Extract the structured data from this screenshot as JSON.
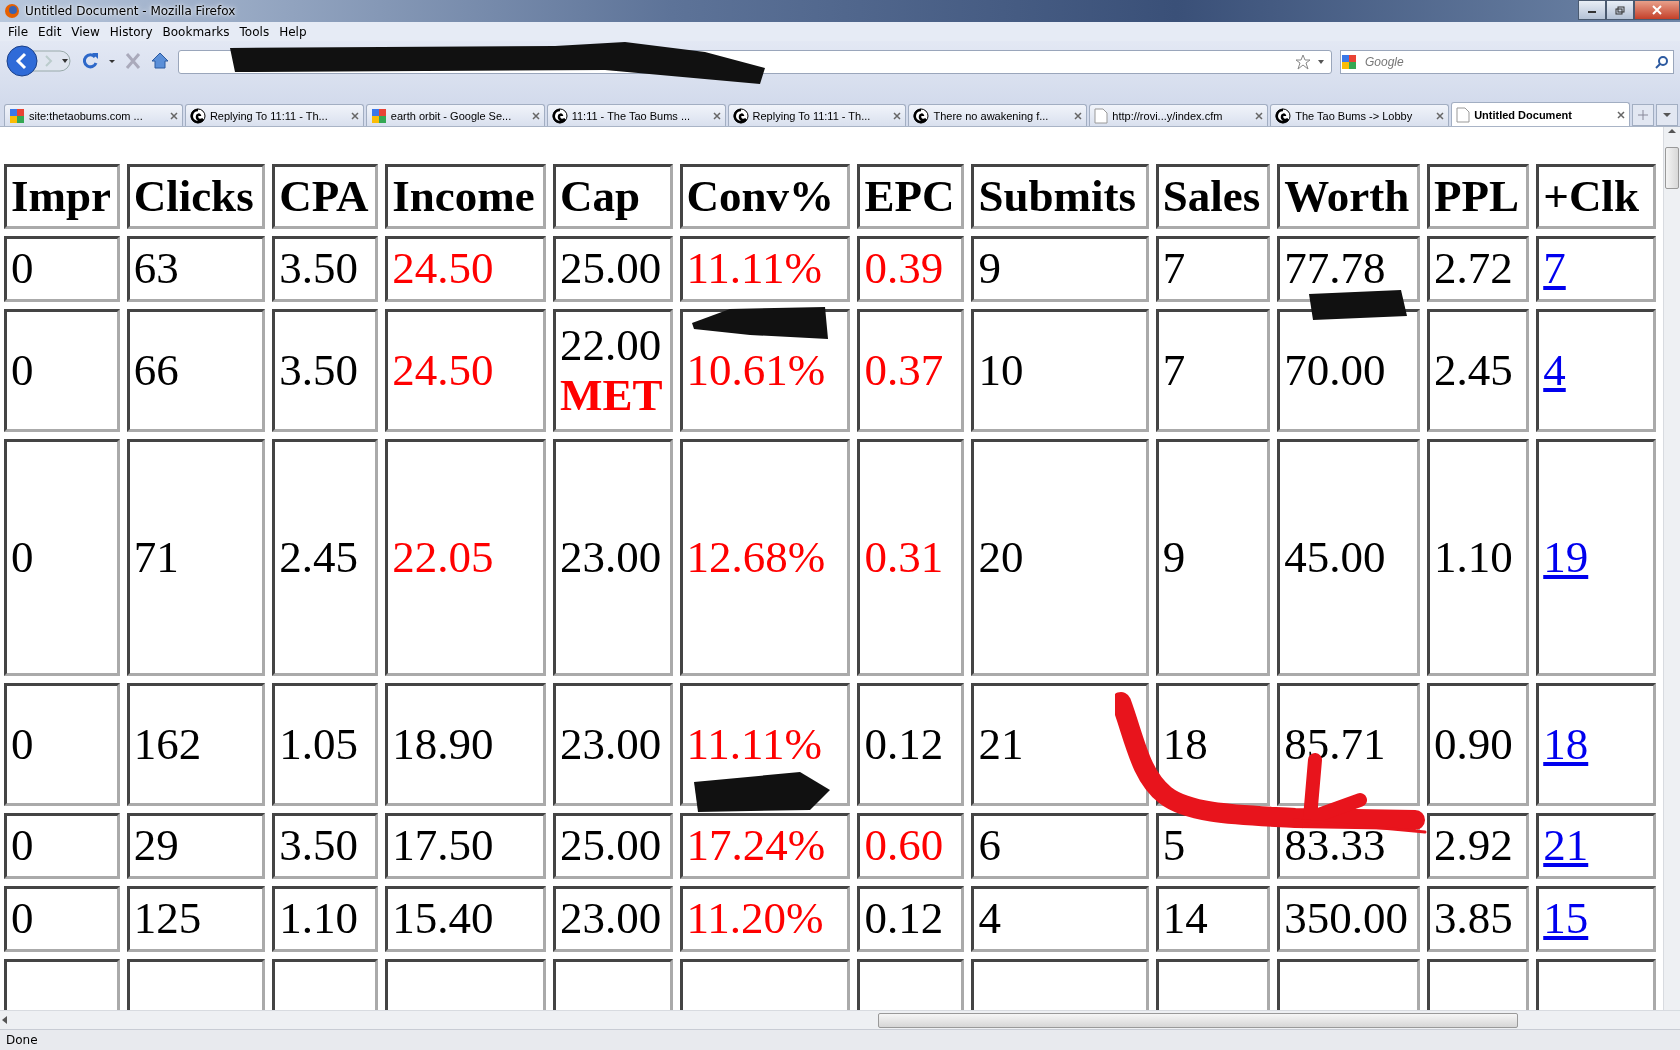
{
  "window": {
    "title": "Untitled Document - Mozilla Firefox"
  },
  "menu": [
    "File",
    "Edit",
    "View",
    "History",
    "Bookmarks",
    "Tools",
    "Help"
  ],
  "search": {
    "placeholder": "Google"
  },
  "tabs": [
    {
      "label": "site:thetaobums.com ...",
      "kind": "google",
      "selected": false
    },
    {
      "label": "Replying To 11:11 - Th...",
      "kind": "forum",
      "selected": false
    },
    {
      "label": "earth orbit - Google Se...",
      "kind": "google",
      "selected": false
    },
    {
      "label": "11:11 - The Tao Bums ...",
      "kind": "forum",
      "selected": false
    },
    {
      "label": "Replying To 11:11 - Th...",
      "kind": "forum",
      "selected": false
    },
    {
      "label": "There no awakening f...",
      "kind": "forum",
      "selected": false
    },
    {
      "label": "http://rovi...y/index.cfm",
      "kind": "page",
      "selected": false
    },
    {
      "label": "The Tao Bums -> Lobby",
      "kind": "forum",
      "selected": false
    },
    {
      "label": "Untitled Document",
      "kind": "page",
      "selected": true
    }
  ],
  "table": {
    "columns": [
      "Impr",
      "Clicks",
      "CPA",
      "Income",
      "Cap",
      "Conv%",
      "EPC",
      "Submits",
      "Sales",
      "Worth",
      "PPL",
      "+Clk"
    ],
    "rows": [
      {
        "cells": [
          {
            "text": "0",
            "kind": "plain"
          },
          {
            "text": "63",
            "kind": "plain"
          },
          {
            "text": "3.50",
            "kind": "plain"
          },
          {
            "text": "24.50",
            "kind": "red"
          },
          {
            "text": "25.00",
            "kind": "plain"
          },
          {
            "text": "11.11%",
            "kind": "red"
          },
          {
            "text": "0.39",
            "kind": "red"
          },
          {
            "text": "9",
            "kind": "plain"
          },
          {
            "text": "7",
            "kind": "plain"
          },
          {
            "text": "77.78",
            "kind": "plain"
          },
          {
            "text": "2.72",
            "kind": "plain"
          },
          {
            "text": "7",
            "kind": "link"
          }
        ]
      },
      {
        "cells": [
          {
            "text": "0",
            "kind": "plain"
          },
          {
            "text": "66",
            "kind": "plain"
          },
          {
            "text": "3.50",
            "kind": "plain"
          },
          {
            "text": "24.50",
            "kind": "red"
          },
          {
            "text": "22.00",
            "kind": "plain",
            "note": "MET"
          },
          {
            "text": "10.61%",
            "kind": "red"
          },
          {
            "text": "0.37",
            "kind": "red"
          },
          {
            "text": "10",
            "kind": "plain"
          },
          {
            "text": "7",
            "kind": "plain"
          },
          {
            "text": "70.00",
            "kind": "plain"
          },
          {
            "text": "2.45",
            "kind": "plain"
          },
          {
            "text": "4",
            "kind": "link"
          }
        ]
      },
      {
        "cells": [
          {
            "text": "0",
            "kind": "plain"
          },
          {
            "text": "71",
            "kind": "plain"
          },
          {
            "text": "2.45",
            "kind": "plain"
          },
          {
            "text": "22.05",
            "kind": "red"
          },
          {
            "text": "23.00",
            "kind": "plain"
          },
          {
            "text": "12.68%",
            "kind": "red"
          },
          {
            "text": "0.31",
            "kind": "red"
          },
          {
            "text": "20",
            "kind": "plain"
          },
          {
            "text": "9",
            "kind": "plain"
          },
          {
            "text": "45.00",
            "kind": "plain"
          },
          {
            "text": "1.10",
            "kind": "plain"
          },
          {
            "text": "19",
            "kind": "link"
          }
        ]
      },
      {
        "cells": [
          {
            "text": "0",
            "kind": "plain"
          },
          {
            "text": "162",
            "kind": "plain"
          },
          {
            "text": "1.05",
            "kind": "plain"
          },
          {
            "text": "18.90",
            "kind": "plain"
          },
          {
            "text": "23.00",
            "kind": "plain"
          },
          {
            "text": "11.11%",
            "kind": "red"
          },
          {
            "text": "0.12",
            "kind": "plain"
          },
          {
            "text": "21",
            "kind": "plain"
          },
          {
            "text": "18",
            "kind": "plain"
          },
          {
            "text": "85.71",
            "kind": "plain"
          },
          {
            "text": "0.90",
            "kind": "plain"
          },
          {
            "text": "18",
            "kind": "link"
          }
        ]
      },
      {
        "cells": [
          {
            "text": "0",
            "kind": "plain"
          },
          {
            "text": "29",
            "kind": "plain"
          },
          {
            "text": "3.50",
            "kind": "plain"
          },
          {
            "text": "17.50",
            "kind": "plain"
          },
          {
            "text": "25.00",
            "kind": "plain"
          },
          {
            "text": "17.24%",
            "kind": "red"
          },
          {
            "text": "0.60",
            "kind": "red"
          },
          {
            "text": "6",
            "kind": "plain"
          },
          {
            "text": "5",
            "kind": "plain"
          },
          {
            "text": "83.33",
            "kind": "plain"
          },
          {
            "text": "2.92",
            "kind": "plain"
          },
          {
            "text": "21",
            "kind": "link"
          }
        ]
      },
      {
        "cells": [
          {
            "text": "0",
            "kind": "plain"
          },
          {
            "text": "125",
            "kind": "plain"
          },
          {
            "text": "1.10",
            "kind": "plain"
          },
          {
            "text": "15.40",
            "kind": "plain"
          },
          {
            "text": "23.00",
            "kind": "plain"
          },
          {
            "text": "11.20%",
            "kind": "red"
          },
          {
            "text": "0.12",
            "kind": "plain"
          },
          {
            "text": "4",
            "kind": "plain"
          },
          {
            "text": "14",
            "kind": "plain"
          },
          {
            "text": "350.00",
            "kind": "plain"
          },
          {
            "text": "3.85",
            "kind": "plain"
          },
          {
            "text": "15",
            "kind": "link"
          }
        ]
      }
    ]
  },
  "status_bar": "Done"
}
